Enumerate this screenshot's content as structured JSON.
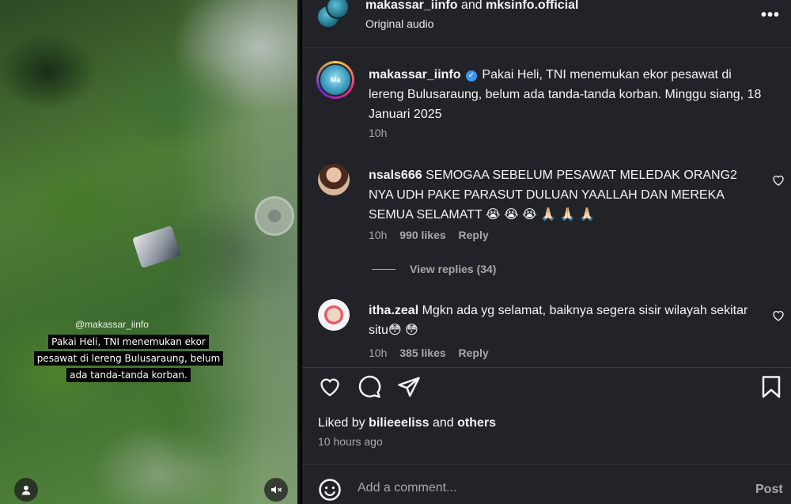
{
  "video": {
    "watermark": "@makassar_iinfo",
    "caption": "Pakai Heli, TNI menemukan ekor pesawat di lereng Bulusaraung, belum ada tanda-tanda korban.",
    "icons": {
      "user": "user-icon",
      "mute": "speaker-muted-icon"
    }
  },
  "header": {
    "account1": "makassar_iinfo",
    "and": "and",
    "account2": "mksinfo.official",
    "audio": "Original audio",
    "more_icon": "more-horizontal-icon"
  },
  "caption_post": {
    "username": "makassar_iinfo",
    "avatar_text": "Ma",
    "text": "Pakai Heli, TNI menemukan ekor pesawat di lereng Bulusaraung, belum ada tanda-tanda korban. Minggu siang, 18 Januari 2025",
    "time": "10h"
  },
  "comments": [
    {
      "username": "nsals666",
      "text": "SEMOGAA SEBELUM PESAWAT MELEDAK ORANG2 NYA UDH PAKE PARASUT DULUAN YAALLAH DAN MEREKA SEMUA SELAMATT 😭 😭 😭 🙏🏻 🙏🏻 🙏🏻",
      "time": "10h",
      "likes": "990 likes",
      "reply": "Reply"
    },
    {
      "username": "itha.zeal",
      "text": "Mgkn ada yg selamat, baiknya segera sisir wilayah sekitar situ😳 😳",
      "time": "10h",
      "likes": "385 likes",
      "reply": "Reply"
    }
  ],
  "view_replies": "View replies (34)",
  "actions": {
    "like": "heart-icon",
    "comment": "comment-icon",
    "share": "share-icon",
    "save": "bookmark-icon"
  },
  "liked_by": {
    "prefix": "Liked by",
    "user": "bilieeeliss",
    "and": "and",
    "others": "others"
  },
  "posted_ago": "10 hours ago",
  "comment_box": {
    "placeholder": "Add a comment...",
    "post_label": "Post",
    "emoji_icon": "emoji-icon"
  }
}
